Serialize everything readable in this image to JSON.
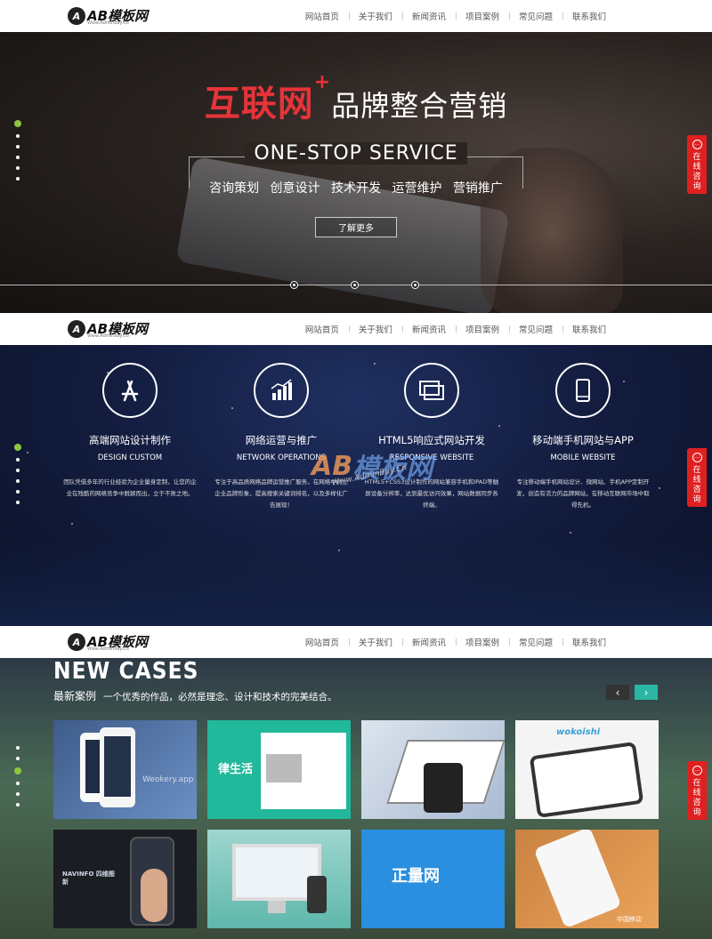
{
  "header": {
    "logo_text": "AB模板网",
    "logo_sub": "Www.Admin8ay.Co",
    "nav": [
      "网站首页",
      "关于我们",
      "新闻资讯",
      "项目案例",
      "常见问题",
      "联系我们"
    ]
  },
  "online_badge": {
    "label": "在线咨询"
  },
  "hero": {
    "title_red": "互联网",
    "title_plus": "+",
    "title_white": "品牌整合营销",
    "subtitle": "ONE-STOP SERVICE",
    "services": [
      "咨询策划",
      "创意设计",
      "技术开发",
      "运营维护",
      "营销推广"
    ],
    "button": "了解更多"
  },
  "features": [
    {
      "icon": "app-store-icon",
      "title": "高端网站设计制作",
      "en": "DESIGN CUSTOM",
      "desc": "团队凭借多年的行业经验为企业量身定制，让您的企业在残酷的网络竞争中脱颖而出，立于不败之地。"
    },
    {
      "icon": "bar-chart-icon",
      "title": "网络运营与推广",
      "en": "NETWORK OPERATIONS",
      "desc": "专注于高品质网络品牌运营推广服务，在网络中树立企业品牌形象，提高搜索关键词排名，以及多样化广告展现！"
    },
    {
      "icon": "screens-icon",
      "title": "HTML5响应式网站开发",
      "en": "RESPONSIVE WEBSITE",
      "desc": "HTML5+CSS3设计制作的网站兼容手机和IPAD等触屏设备分辨率，达到最优访问效果，网站数据同步各终端。"
    },
    {
      "icon": "mobile-phone-icon",
      "title": "移动端手机网站与APP",
      "en": "MOBILE WEBSITE",
      "desc": "专注移动端手机网站设计、微网站、手机APP定制开发，创造有活力的品牌网站，在移动互联网市场中取得先机。"
    }
  ],
  "watermark": {
    "text1": "AB",
    "text2": "模板网",
    "sub": "Www.AdminBuy.Cn"
  },
  "cases": {
    "title": "NEW CASES",
    "subtitle": "最新案例",
    "desc": "一个优秀的作品，必然是理念、设计和技术的完美结合。",
    "prev": "‹",
    "next": "›",
    "thumb_labels": [
      "Weokery.app",
      "律生活",
      "",
      "wokoishi",
      "NAVINFO 四维图新",
      "",
      "正量网",
      "中国移动"
    ]
  },
  "colors": {
    "accent_red": "#e63339",
    "accent_green": "#8dc63f",
    "badge_red": "#e02020",
    "teal": "#2bb7a4"
  }
}
